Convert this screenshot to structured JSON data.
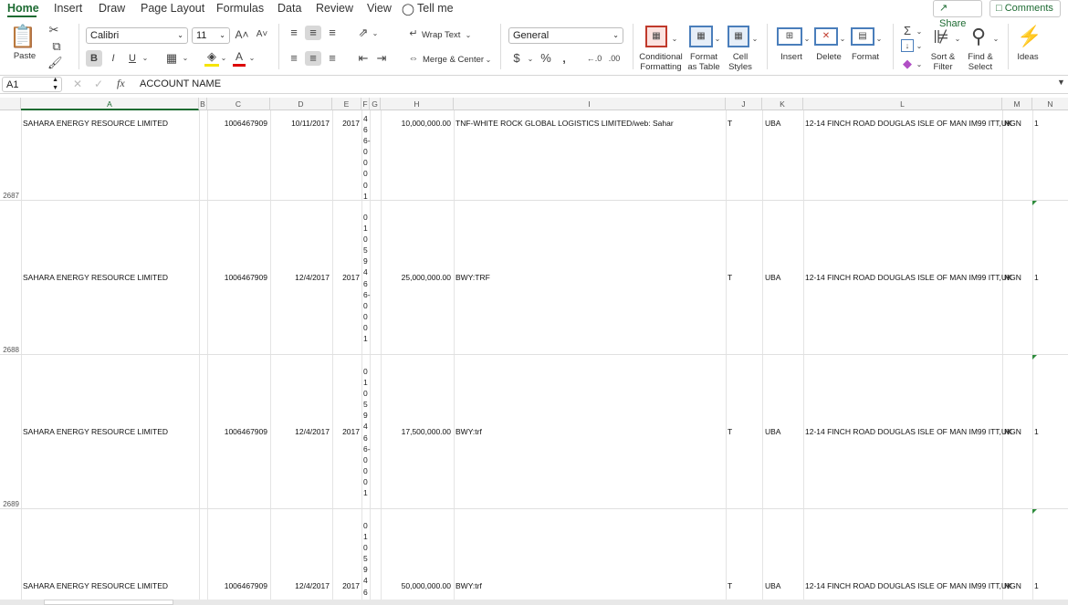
{
  "tabs": [
    "Home",
    "Insert",
    "Draw",
    "Page Layout",
    "Formulas",
    "Data",
    "Review",
    "View"
  ],
  "tell_me": "Tell me",
  "share": "Share",
  "comments": "Comments",
  "ribbon": {
    "paste": "Paste",
    "font": "Calibri",
    "size": "11",
    "wrap": "Wrap Text",
    "merge": "Merge & Center",
    "format": "General",
    "cond": [
      "Conditional",
      "Formatting"
    ],
    "fat": [
      "Format",
      "as Table"
    ],
    "cs": [
      "Cell",
      "Styles"
    ],
    "insert": "Insert",
    "delete": "Delete",
    "fmt": "Format",
    "sort": [
      "Sort &",
      "Filter"
    ],
    "find": [
      "Find &",
      "Select"
    ],
    "ideas": "Ideas",
    "bold": "B",
    "italic": "I",
    "underline": "U"
  },
  "formula_bar": {
    "name_box": "A1",
    "fx": "fx",
    "content": "ACCOUNT NAME"
  },
  "columns": [
    "A",
    "B",
    "C",
    "D",
    "E",
    "F",
    "G",
    "H",
    "I",
    "J",
    "K",
    "L",
    "M",
    "N"
  ],
  "rows": [
    {
      "num": "2687",
      "a": "SAHARA ENERGY RESOURCE LIMITED",
      "c": "1006467909",
      "d": "10/11/2017",
      "e": "2017",
      "f": [
        "4",
        "6",
        "6-",
        "0",
        "0",
        "0",
        "0",
        "1"
      ],
      "h": "10,000,000.00",
      "i": "TNF-WHITE ROCK GLOBAL LOGISTICS LIMITED/web: Sahar",
      "j": "T",
      "k": "UBA",
      "l": "12-14 FINCH ROAD DOUGLAS ISLE OF MAN IM99 ITT,UK",
      "m": "NGN",
      "n": "1"
    },
    {
      "num": "2688",
      "a": "SAHARA ENERGY RESOURCE LIMITED",
      "c": "1006467909",
      "d": "12/4/2017",
      "e": "2017",
      "f": [
        "0",
        "1",
        "0",
        "5",
        "9",
        "4",
        "6",
        "6-",
        "0",
        "0",
        "0",
        "1"
      ],
      "h": "25,000,000.00",
      "i": "BWY:TRF",
      "j": "T",
      "k": "UBA",
      "l": "12-14 FINCH ROAD DOUGLAS ISLE OF MAN IM99 ITT,UK",
      "m": "NGN",
      "n": "1"
    },
    {
      "num": "2689",
      "a": "SAHARA ENERGY RESOURCE LIMITED",
      "c": "1006467909",
      "d": "12/4/2017",
      "e": "2017",
      "f": [
        "0",
        "1",
        "0",
        "5",
        "9",
        "4",
        "6",
        "6-",
        "0",
        "0",
        "0",
        "1"
      ],
      "h": "17,500,000.00",
      "i": "BWY:trf",
      "j": "T",
      "k": "UBA",
      "l": "12-14 FINCH ROAD DOUGLAS ISLE OF MAN IM99 ITT,UK",
      "m": "NGN",
      "n": "1"
    },
    {
      "num": "",
      "a": "SAHARA ENERGY RESOURCE LIMITED",
      "c": "1006467909",
      "d": "12/4/2017",
      "e": "2017",
      "f": [
        "0",
        "1",
        "0",
        "5",
        "9",
        "4",
        "6"
      ],
      "h": "50,000,000.00",
      "i": "BWY:trf",
      "j": "T",
      "k": "UBA",
      "l": "12-14 FINCH ROAD DOUGLAS ISLE OF MAN IM99 ITT,UK",
      "m": "NGN",
      "n": "1"
    }
  ]
}
